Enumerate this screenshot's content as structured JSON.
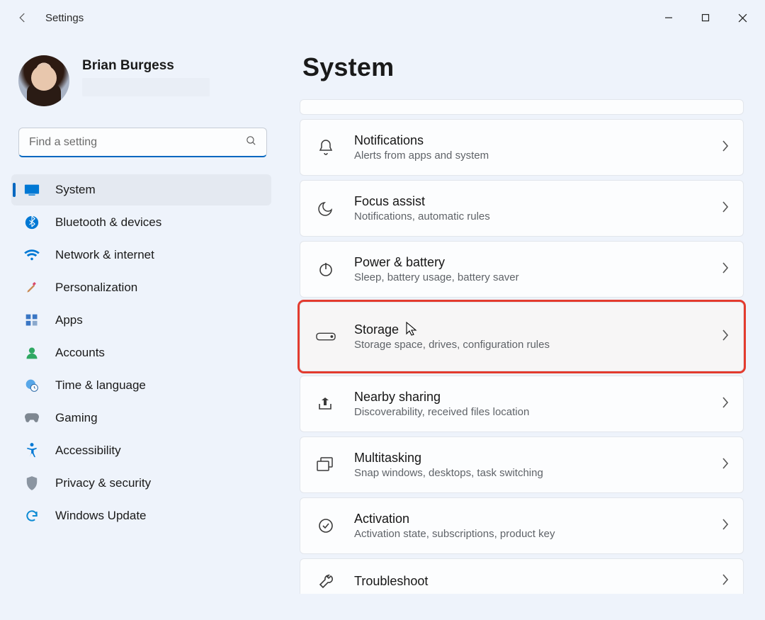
{
  "window": {
    "title": "Settings"
  },
  "profile": {
    "name": "Brian Burgess"
  },
  "search": {
    "placeholder": "Find a setting"
  },
  "sidebar": {
    "items": [
      {
        "id": "system",
        "label": "System",
        "active": true
      },
      {
        "id": "bluetooth",
        "label": "Bluetooth & devices"
      },
      {
        "id": "network",
        "label": "Network & internet"
      },
      {
        "id": "personalization",
        "label": "Personalization"
      },
      {
        "id": "apps",
        "label": "Apps"
      },
      {
        "id": "accounts",
        "label": "Accounts"
      },
      {
        "id": "time",
        "label": "Time & language"
      },
      {
        "id": "gaming",
        "label": "Gaming"
      },
      {
        "id": "accessibility",
        "label": "Accessibility"
      },
      {
        "id": "privacy",
        "label": "Privacy & security"
      },
      {
        "id": "update",
        "label": "Windows Update"
      }
    ]
  },
  "page": {
    "title": "System"
  },
  "cards": [
    {
      "id": "notifications",
      "title": "Notifications",
      "sub": "Alerts from apps and system"
    },
    {
      "id": "focus",
      "title": "Focus assist",
      "sub": "Notifications, automatic rules"
    },
    {
      "id": "power",
      "title": "Power & battery",
      "sub": "Sleep, battery usage, battery saver"
    },
    {
      "id": "storage",
      "title": "Storage",
      "sub": "Storage space, drives, configuration rules",
      "highlight": true
    },
    {
      "id": "nearby",
      "title": "Nearby sharing",
      "sub": "Discoverability, received files location"
    },
    {
      "id": "multitask",
      "title": "Multitasking",
      "sub": "Snap windows, desktops, task switching"
    },
    {
      "id": "activation",
      "title": "Activation",
      "sub": "Activation state, subscriptions, product key"
    },
    {
      "id": "troubleshoot",
      "title": "Troubleshoot",
      "sub": ""
    }
  ]
}
